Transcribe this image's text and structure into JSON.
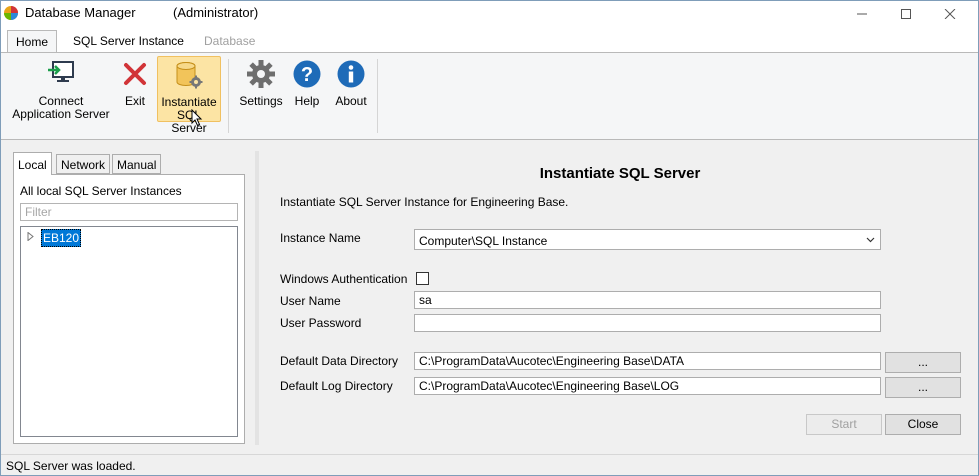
{
  "window": {
    "title": "Database Manager",
    "user": "(Administrator)"
  },
  "ribbon": {
    "tabs": [
      {
        "label": "Home",
        "active": true,
        "enabled": true
      },
      {
        "label": "SQL Server Instance",
        "active": false,
        "enabled": true
      },
      {
        "label": "Database",
        "active": false,
        "enabled": false
      }
    ],
    "buttons": {
      "connect": {
        "line1": "Connect",
        "line2": "Application Server",
        "icon": "connect-icon"
      },
      "exit": {
        "label": "Exit",
        "icon": "red-x-icon"
      },
      "instantiate": {
        "line1": "Instantiate",
        "line2": "SQL Server",
        "icon": "database-gear-icon"
      },
      "settings": {
        "label": "Settings",
        "icon": "gear-icon"
      },
      "help": {
        "label": "Help",
        "icon": "question-icon"
      },
      "about": {
        "label": "About",
        "icon": "info-icon"
      }
    }
  },
  "left_panel": {
    "tabs": [
      {
        "label": "Local",
        "active": true
      },
      {
        "label": "Network",
        "active": false
      },
      {
        "label": "Manual",
        "active": false
      }
    ],
    "section_title": "All local SQL Server Instances",
    "filter_placeholder": "Filter",
    "instances": [
      {
        "label": "EB120",
        "selected": true
      }
    ]
  },
  "form": {
    "title": "Instantiate SQL Server",
    "description": "Instantiate SQL Server Instance for Engineering Base.",
    "instance_name_label": "Instance Name",
    "instance_name_value": "Computer\\SQL Instance",
    "windows_auth_label": "Windows Authentication",
    "windows_auth_checked": false,
    "user_name_label": "User Name",
    "user_name_value": "sa",
    "user_password_label": "User Password",
    "user_password_value": "",
    "data_dir_label": "Default Data Directory",
    "data_dir_value": "C:\\ProgramData\\Aucotec\\Engineering Base\\DATA",
    "log_dir_label": "Default Log Directory",
    "log_dir_value": "C:\\ProgramData\\Aucotec\\Engineering Base\\LOG",
    "browse_label": "...",
    "start_label": "Start",
    "close_label": "Close"
  },
  "status": {
    "text": "SQL Server was loaded."
  },
  "colors": {
    "accent_selected": "#0078d7",
    "ribbon_highlight": "#fce4a4",
    "exit_red": "#d13438",
    "icon_blue": "#1e6bb8",
    "icon_gray": "#6e6e6e"
  }
}
